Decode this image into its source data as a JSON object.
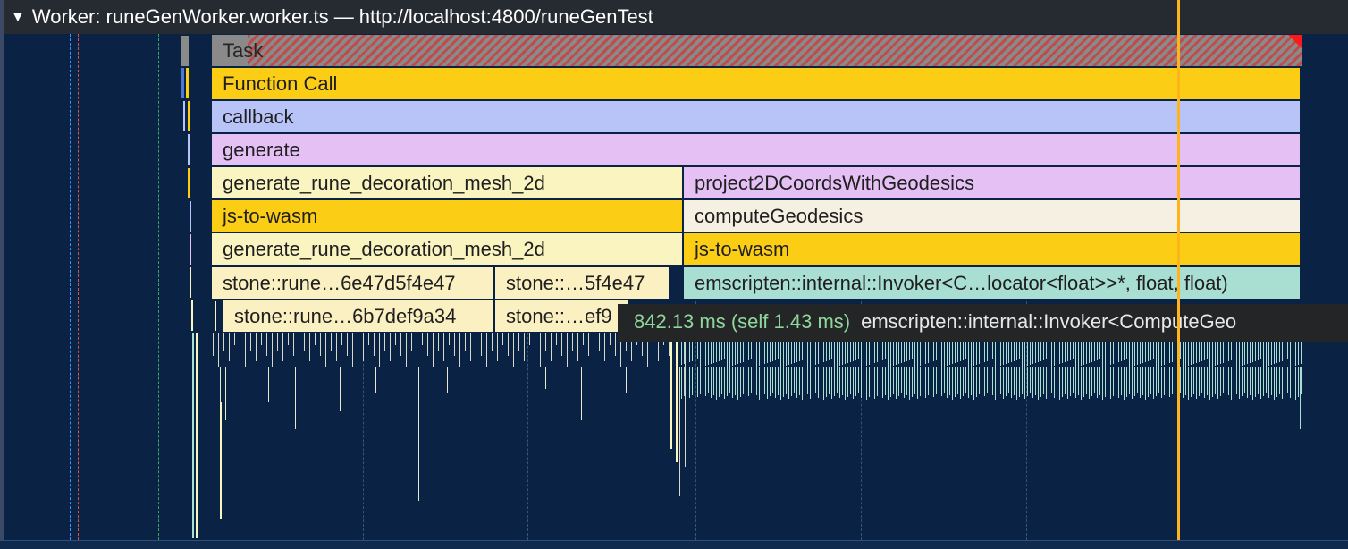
{
  "track": {
    "expand_icon": "triangle-down-icon",
    "title": "Worker: runeGenWorker.worker.ts — http://localhost:4800/runeGenTest"
  },
  "flame": {
    "task": "Task",
    "function_call": "Function Call",
    "callback": "callback",
    "generate": "generate",
    "gen_rune_1": "generate_rune_decoration_mesh_2d",
    "project": "project2DCoordsWithGeodesics",
    "wasm_1": "js-to-wasm",
    "compute": "computeGeodesics",
    "gen_rune_2": "generate_rune_decoration_mesh_2d",
    "wasm_2": "js-to-wasm",
    "stone_1": "stone::rune…6e47d5f4e47",
    "stone_2": "stone::…5f4e47",
    "emscripten": "emscripten::internal::Invoker<C…locator<float>>*, float, float)",
    "stone_3": "stone::rune…6b7def9a34",
    "stone_4": "stone::…ef9"
  },
  "tooltip": {
    "time": "842.13 ms (self 1.43 ms)",
    "name": "emscripten::internal::Invoker<ComputeGeo"
  },
  "colors": {
    "background": "#0a2244",
    "header": "#262a31",
    "function_call": "#fbcd15",
    "callback": "#b8c3f8",
    "generate": "#e5c0f5",
    "emscripten": "#a9dfd3",
    "cursor": "#ffb31f",
    "tooltip_time": "#8fd89a"
  }
}
